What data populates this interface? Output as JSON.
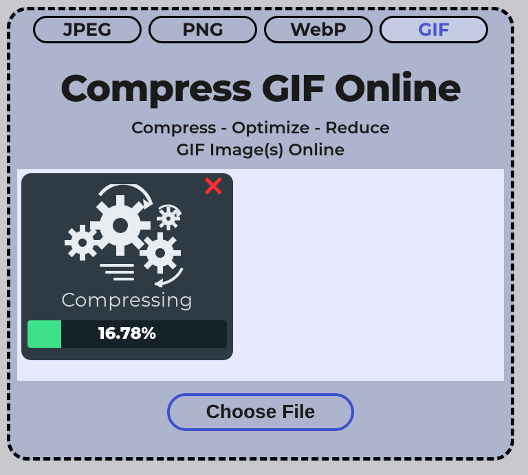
{
  "tabs": [
    {
      "label": "JPEG",
      "active": false
    },
    {
      "label": "PNG",
      "active": false
    },
    {
      "label": "WebP",
      "active": false
    },
    {
      "label": "GIF",
      "active": true
    }
  ],
  "title": "Compress GIF Online",
  "subtitle_line1": "Compress - Optimize - Reduce",
  "subtitle_line2": "GIF Image(s) Online",
  "card": {
    "close_symbol": "✕",
    "label": "Compressing",
    "progress_percent": 16.78,
    "progress_text": "16.78%"
  },
  "choose_file_label": "Choose File",
  "colors": {
    "page_bg": "#c9c9cd",
    "panel_bg": "#adb4cd",
    "accent_blue": "#3c50cf",
    "active_tab_text": "#4a55d0",
    "dropzone_bg": "#e6e9ff",
    "card_bg": "#2f3b44",
    "progress_track": "#16222a",
    "progress_fill": "#3ee08a",
    "close_red": "#ff2d2d"
  }
}
